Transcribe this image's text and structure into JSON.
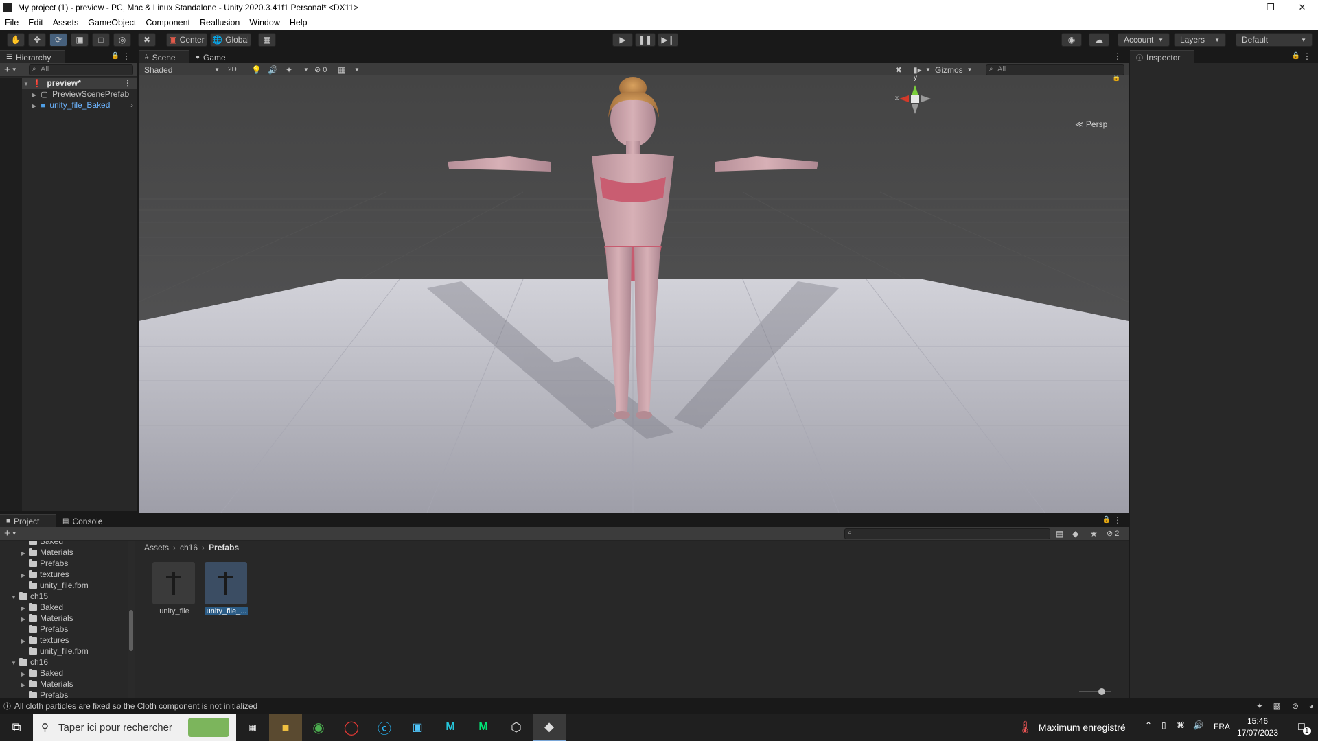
{
  "window": {
    "title": "My project (1) - preview - PC, Mac & Linux Standalone - Unity 2020.3.41f1 Personal* <DX11>"
  },
  "menu": [
    "File",
    "Edit",
    "Assets",
    "GameObject",
    "Component",
    "Reallusion",
    "Window",
    "Help"
  ],
  "toolbar": {
    "pivot_label": "Center",
    "space_label": "Global",
    "account_label": "Account",
    "layers_label": "Layers",
    "layout_label": "Default"
  },
  "hierarchy": {
    "tab": "Hierarchy",
    "search_placeholder": "All",
    "items": [
      {
        "label": "preview*"
      },
      {
        "label": "PreviewScenePrefab"
      },
      {
        "label": "unity_file_Baked"
      }
    ]
  },
  "scene": {
    "tab_scene": "Scene",
    "tab_game": "Game",
    "shading": "Shaded",
    "mode_2d": "2D",
    "hidden_count": "0",
    "gizmos_label": "Gizmos",
    "search_placeholder": "All",
    "gizmo_y": "y",
    "gizmo_x": "x",
    "persp_label": "Persp"
  },
  "inspector": {
    "tab": "Inspector"
  },
  "project": {
    "tab_project": "Project",
    "tab_console": "Console",
    "hidden_count": "2",
    "tree": [
      {
        "label": "Baked",
        "indent": 2,
        "arrow": false
      },
      {
        "label": "Materials",
        "indent": 2,
        "arrow": true
      },
      {
        "label": "Prefabs",
        "indent": 2,
        "arrow": false
      },
      {
        "label": "textures",
        "indent": 2,
        "arrow": true
      },
      {
        "label": "unity_file.fbm",
        "indent": 2,
        "arrow": false
      },
      {
        "label": "ch15",
        "indent": 1,
        "arrow": true,
        "open": true
      },
      {
        "label": "Baked",
        "indent": 2,
        "arrow": true
      },
      {
        "label": "Materials",
        "indent": 2,
        "arrow": true
      },
      {
        "label": "Prefabs",
        "indent": 2,
        "arrow": false
      },
      {
        "label": "textures",
        "indent": 2,
        "arrow": true
      },
      {
        "label": "unity_file.fbm",
        "indent": 2,
        "arrow": false
      },
      {
        "label": "ch16",
        "indent": 1,
        "arrow": true,
        "open": true
      },
      {
        "label": "Baked",
        "indent": 2,
        "arrow": true
      },
      {
        "label": "Materials",
        "indent": 2,
        "arrow": true
      },
      {
        "label": "Prefabs",
        "indent": 2,
        "arrow": false
      }
    ],
    "breadcrumb": [
      "Assets",
      "ch16",
      "Prefabs"
    ],
    "assets": [
      {
        "label": "unity_file",
        "selected": false
      },
      {
        "label": "unity_file_...",
        "selected": true
      }
    ]
  },
  "status": {
    "message": "All cloth particles are fixed so the Cloth component is not initialized"
  },
  "taskbar": {
    "search_placeholder": "Taper ici pour rechercher",
    "weather_text": "Maximum enregistré",
    "language": "FRA",
    "time": "15:46",
    "date": "17/07/2023",
    "notification_count": "1"
  },
  "colors": {
    "editor_bg": "#282828",
    "toolbar_bg": "#191919",
    "selection": "#2c5d87",
    "scene_sky": "#474747",
    "floor": "#b9b9c3"
  }
}
